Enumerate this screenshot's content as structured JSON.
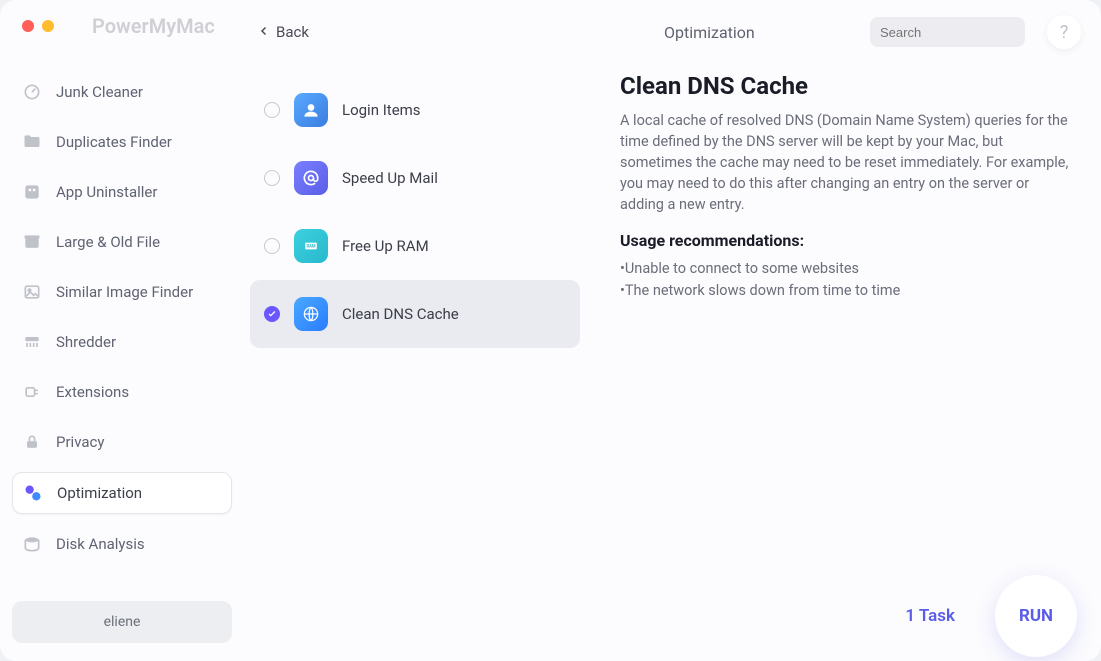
{
  "app": {
    "title": "PowerMyMac"
  },
  "topbar": {
    "back_label": "Back",
    "breadcrumb": "Optimization",
    "search_placeholder": "Search",
    "help_label": "?"
  },
  "sidebar": {
    "items": [
      {
        "label": "Junk Cleaner",
        "icon": "gauge-icon"
      },
      {
        "label": "Duplicates Finder",
        "icon": "folder-icon"
      },
      {
        "label": "App Uninstaller",
        "icon": "app-grid-icon"
      },
      {
        "label": "Large & Old File",
        "icon": "archive-icon"
      },
      {
        "label": "Similar Image Finder",
        "icon": "image-icon"
      },
      {
        "label": "Shredder",
        "icon": "shredder-icon"
      },
      {
        "label": "Extensions",
        "icon": "plug-icon"
      },
      {
        "label": "Privacy",
        "icon": "lock-icon"
      },
      {
        "label": "Optimization",
        "icon": "optimization-icon"
      },
      {
        "label": "Disk Analysis",
        "icon": "disk-icon"
      }
    ]
  },
  "account": {
    "username": "eliene"
  },
  "options": {
    "items": [
      {
        "label": "Login Items",
        "icon": "person-icon",
        "selected": false
      },
      {
        "label": "Speed Up Mail",
        "icon": "at-icon",
        "selected": false
      },
      {
        "label": "Free Up RAM",
        "icon": "ram-icon",
        "selected": false
      },
      {
        "label": "Clean DNS Cache",
        "icon": "dns-icon",
        "selected": true
      }
    ]
  },
  "detail": {
    "title": "Clean DNS Cache",
    "description": "A local cache of resolved DNS (Domain Name System) queries for the time defined by the DNS server will be kept by your Mac, but sometimes the cache may need to be reset immediately. For example, you may need to do this after changing an entry on the server or adding a new entry.",
    "usage_title": "Usage recommendations:",
    "bullets": [
      "Unable to connect to some websites",
      "The network slows down from time to time"
    ]
  },
  "footer": {
    "task_count_label": "1 Task",
    "run_label": "RUN"
  }
}
